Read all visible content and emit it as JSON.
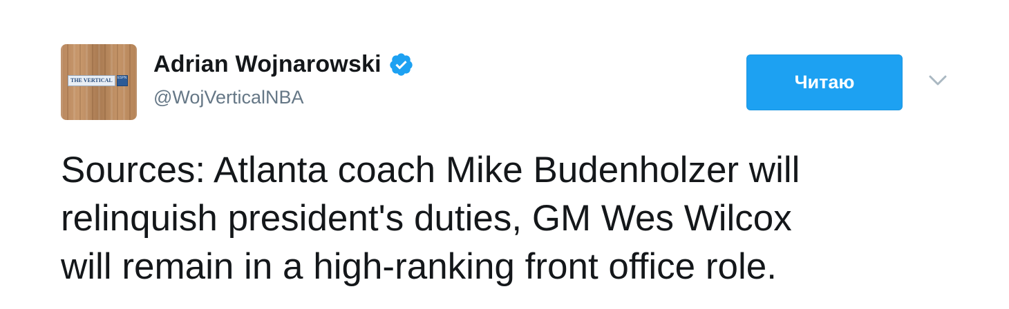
{
  "tweet": {
    "author": {
      "display_name": "Adrian Wojnarowski",
      "handle": "@WojVerticalNBA",
      "verified": true,
      "avatar_badge_text": "THE VERTICAL",
      "avatar_badge_side_text": "ESPN NBA"
    },
    "follow_button_label": "Читаю",
    "menu_icon": "chevron-down-icon",
    "text_lines": [
      "Sources: Atlanta coach Mike Budenholzer will",
      "relinquish president's duties, GM Wes Wilcox",
      "will remain in a high-ranking front office role."
    ]
  },
  "colors": {
    "accent": "#1da1f2",
    "verified": "#1da1f2",
    "text": "#14171a",
    "secondary_text": "#657786",
    "chevron": "#aab8c2"
  }
}
